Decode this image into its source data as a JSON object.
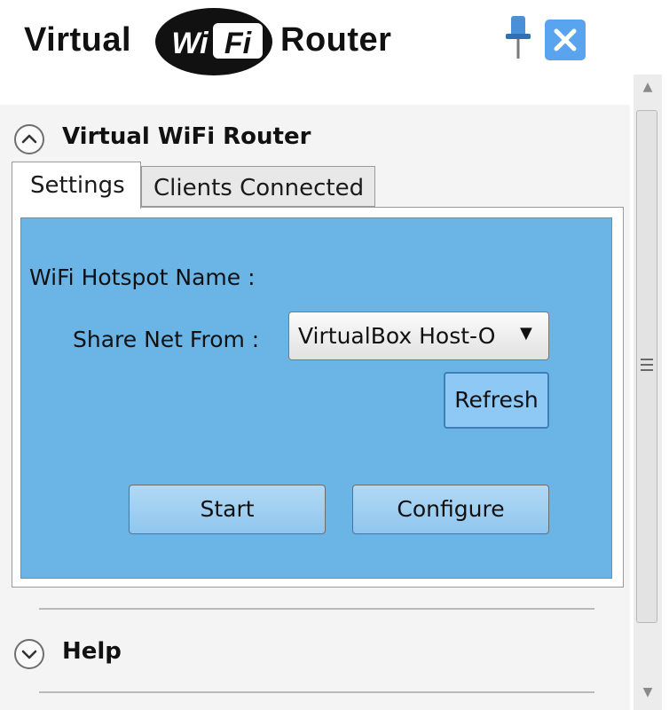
{
  "header": {
    "title_left": "Virtual",
    "logo_text_left": "Wi",
    "logo_text_right": "Fi",
    "title_right": "Router",
    "pin_icon": "pin-icon",
    "close_icon": "close-icon"
  },
  "expanders": [
    {
      "title": "Virtual WiFi Router",
      "state": "expanded",
      "icon": "chevron-up-icon"
    },
    {
      "title": "Help",
      "state": "collapsed",
      "icon": "chevron-down-icon"
    }
  ],
  "tabs": [
    {
      "label": "Settings",
      "selected": true
    },
    {
      "label": "Clients Connected",
      "selected": false
    }
  ],
  "settings": {
    "hotspot_label": "WiFi Hotspot Name :",
    "share_label": "Share Net From :",
    "share_value": "VirtualBox Host-O",
    "refresh_label": "Refresh",
    "start_label": "Start",
    "configure_label": "Configure"
  },
  "colors": {
    "panel_blue": "#6bb5e6",
    "close_blue": "#5aa4ef",
    "refresh_blue": "#8ec9f5"
  }
}
